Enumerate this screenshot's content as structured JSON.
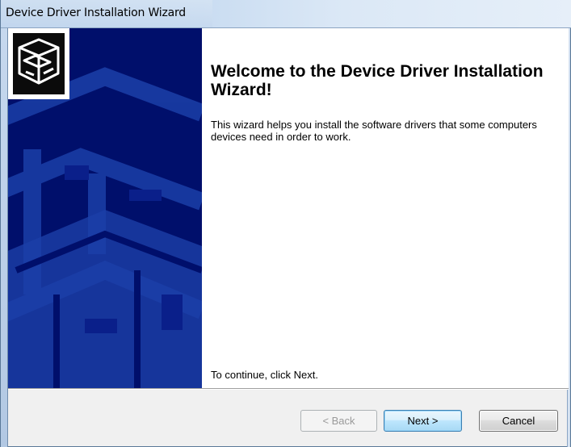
{
  "window": {
    "title": "Device Driver Installation Wizard"
  },
  "wizard": {
    "heading": "Welcome to the Device Driver Installation Wizard!",
    "description": "This wizard helps you install the software drivers that some computers devices need in order to work.",
    "continue_text": "To continue, click Next.",
    "hero_icon": "hardware-box-icon"
  },
  "buttons": {
    "back_label": "< Back",
    "next_label": "Next >",
    "cancel_label": "Cancel",
    "back_enabled": false
  },
  "colors": {
    "banner_background": "#000f6b",
    "banner_pattern": "#1b3fa8",
    "default_button_border": "#3c7fb1"
  }
}
